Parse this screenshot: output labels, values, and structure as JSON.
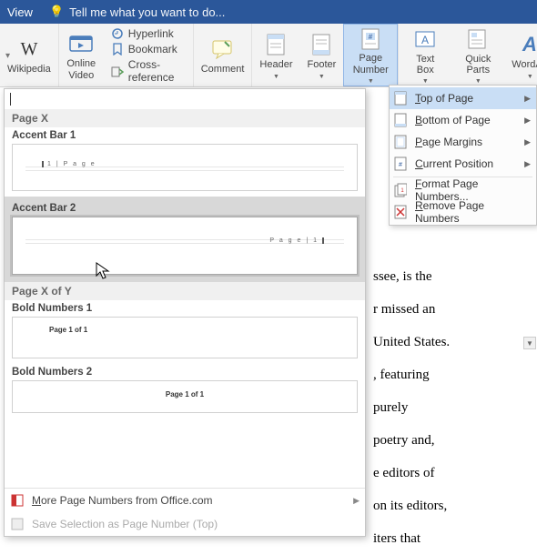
{
  "titlebar": {
    "view": "View",
    "tell": "Tell me what you want to do..."
  },
  "ribbon": {
    "wikipedia": "Wikipedia",
    "online_video": "Online Video",
    "hyperlink": "Hyperlink",
    "bookmark": "Bookmark",
    "crossref": "Cross-reference",
    "comment": "Comment",
    "header": "Header",
    "footer": "Footer",
    "page_number": "Page Number",
    "text_box": "Text Box",
    "quick_parts": "Quick Parts",
    "wordart": "WordArt"
  },
  "menu": {
    "top": "Top of Page",
    "bottom": "Bottom of Page",
    "margins": "Page Margins",
    "current": "Current Position",
    "format": "Format Page Numbers...",
    "remove": "Remove Page Numbers"
  },
  "gallery": {
    "cat1": "Page X",
    "accent1": "Accent Bar 1",
    "accent1_preview": "1 | P a g e",
    "accent2": "Accent Bar 2",
    "accent2_preview": "P a g e | 1",
    "cat2": "Page X of Y",
    "bold1": "Bold Numbers 1",
    "bold1_preview": "Page 1 of 1",
    "bold2": "Bold Numbers 2",
    "bold2_preview": "Page 1 of 1",
    "more": "More Page Numbers from Office.com",
    "save": "Save Selection as Page Number (Top)"
  },
  "doc_lines": [
    "ssee, is the",
    "r missed an",
    "United States.",
    ", featuring",
    "purely",
    "poetry and,",
    "e editors of",
    "on its editors,",
    "iters that"
  ]
}
